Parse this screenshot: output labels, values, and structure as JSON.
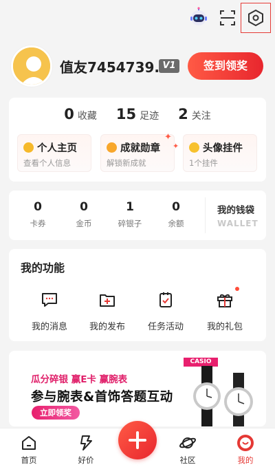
{
  "profile": {
    "username": "值友7454739...",
    "level_badge": "V1",
    "signin_label": "签到领奖"
  },
  "stats": [
    {
      "num": "0",
      "label": "收藏"
    },
    {
      "num": "15",
      "label": "足迹"
    },
    {
      "num": "2",
      "label": "关注"
    }
  ],
  "features": [
    {
      "title": "个人主页",
      "sub": "查看个人信息",
      "icon": "person-icon"
    },
    {
      "title": "成就勋章",
      "sub": "解锁新成就",
      "icon": "medal-icon"
    },
    {
      "title": "头像挂件",
      "sub": "1个挂件",
      "icon": "pendant-icon"
    }
  ],
  "wallet": {
    "items": [
      {
        "num": "0",
        "label": "卡券"
      },
      {
        "num": "0",
        "label": "金币"
      },
      {
        "num": "1",
        "label": "碎银子"
      },
      {
        "num": "0",
        "label": "余额"
      }
    ],
    "title": "我的钱袋",
    "subtitle": "WALLET"
  },
  "functions": {
    "title": "我的功能",
    "items": [
      {
        "label": "我的消息",
        "icon": "message-icon"
      },
      {
        "label": "我的发布",
        "icon": "publish-icon"
      },
      {
        "label": "任务活动",
        "icon": "task-icon"
      },
      {
        "label": "我的礼包",
        "icon": "gift-icon"
      }
    ]
  },
  "banner": {
    "line1": "瓜分碎银 赢E卡 赢腕表",
    "line2": "参与腕表&首饰答题互动",
    "button": "立即领奖",
    "brand": "CASIO"
  },
  "tabbar": [
    {
      "label": "首页",
      "icon": "home-icon"
    },
    {
      "label": "好价",
      "icon": "deal-icon"
    },
    {
      "label": "社区",
      "icon": "planet-icon"
    },
    {
      "label": "我的",
      "icon": "profile-icon"
    }
  ],
  "colors": {
    "accent": "#e53935",
    "brand_pink": "#e0206a"
  }
}
